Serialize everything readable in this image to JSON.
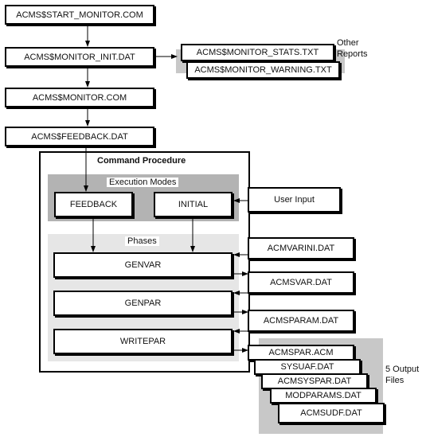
{
  "top_flow": {
    "start_monitor": "ACMS$START_MONITOR.COM",
    "monitor_init": "ACMS$MONITOR_INIT.DAT",
    "monitor_com": "ACMS$MONITOR.COM",
    "feedback_dat": "ACMS$FEEDBACK.DAT"
  },
  "other_reports": {
    "label_line1": "Other",
    "label_line2": "Reports",
    "files": [
      "ACMS$MONITOR_STATS.TXT",
      "ACMS$MONITOR_WARNING.TXT"
    ]
  },
  "command_procedure": {
    "title": "Command Procedure",
    "execution_modes": {
      "title": "Execution Modes",
      "modes": [
        "FEEDBACK",
        "INITIAL"
      ]
    },
    "phases": {
      "title": "Phases",
      "items": [
        "GENVAR",
        "GENPAR",
        "WRITEPAR"
      ]
    }
  },
  "user_input": "User Input",
  "side_files": [
    "ACMVARINI.DAT",
    "ACMSVAR.DAT",
    "ACMSPARAM.DAT"
  ],
  "output_files": {
    "label_line1": "5 Output",
    "label_line2": "Files",
    "files": [
      "ACMSPAR.ACM",
      "SYSUAF.DAT",
      "ACMSYSPAR.DAT",
      "MODPARAMS.DAT",
      "ACMSUDF.DAT"
    ]
  },
  "colors": {
    "shade_dark": "#b3b3b3",
    "shade_light": "#e6e6e6",
    "line": "#000000"
  }
}
